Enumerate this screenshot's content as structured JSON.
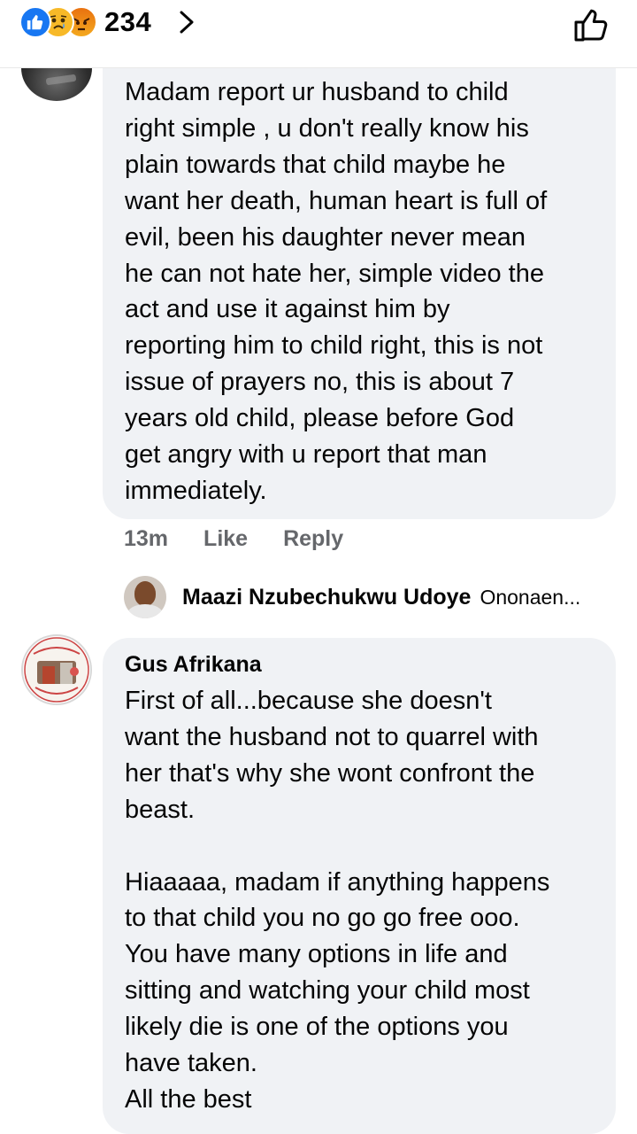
{
  "header": {
    "reaction_count": "234",
    "reaction_icons": [
      "like-icon",
      "sad-icon",
      "angry-icon"
    ]
  },
  "comment1": {
    "author_partial": "",
    "text": "Madam report ur husband to child\nright simple , u don't really know his\nplain towards that child maybe he\nwant her death, human heart is full of\nevil, been his daughter never mean\nhe can not hate her, simple video the\nact and use it against him by\nreporting him to child right, this is not\nissue of prayers no, this is about 7\nyears old child, please before God\nget angry with u report that man\nimmediately.",
    "time": "13m",
    "like_label": "Like",
    "reply_label": "Reply"
  },
  "reply_preview": {
    "name": "Maazi Nzubechukwu Udoye",
    "snippet": "Ononaen..."
  },
  "comment2": {
    "author": "Gus Afrikana",
    "text": "First of all...because she doesn't\nwant the husband not to quarrel with\nher that's why she wont confront the\nbeast.\n\nHiaaaaa, madam if anything happens\nto that child you no go go free ooo.\nYou have many options in life and\nsitting and watching your child most\nlikely die is one of the options you\nhave taken.\nAll the best"
  },
  "colors": {
    "bubble": "#f0f2f5",
    "meta_text": "#65676b",
    "like_blue": "#1877f2"
  }
}
